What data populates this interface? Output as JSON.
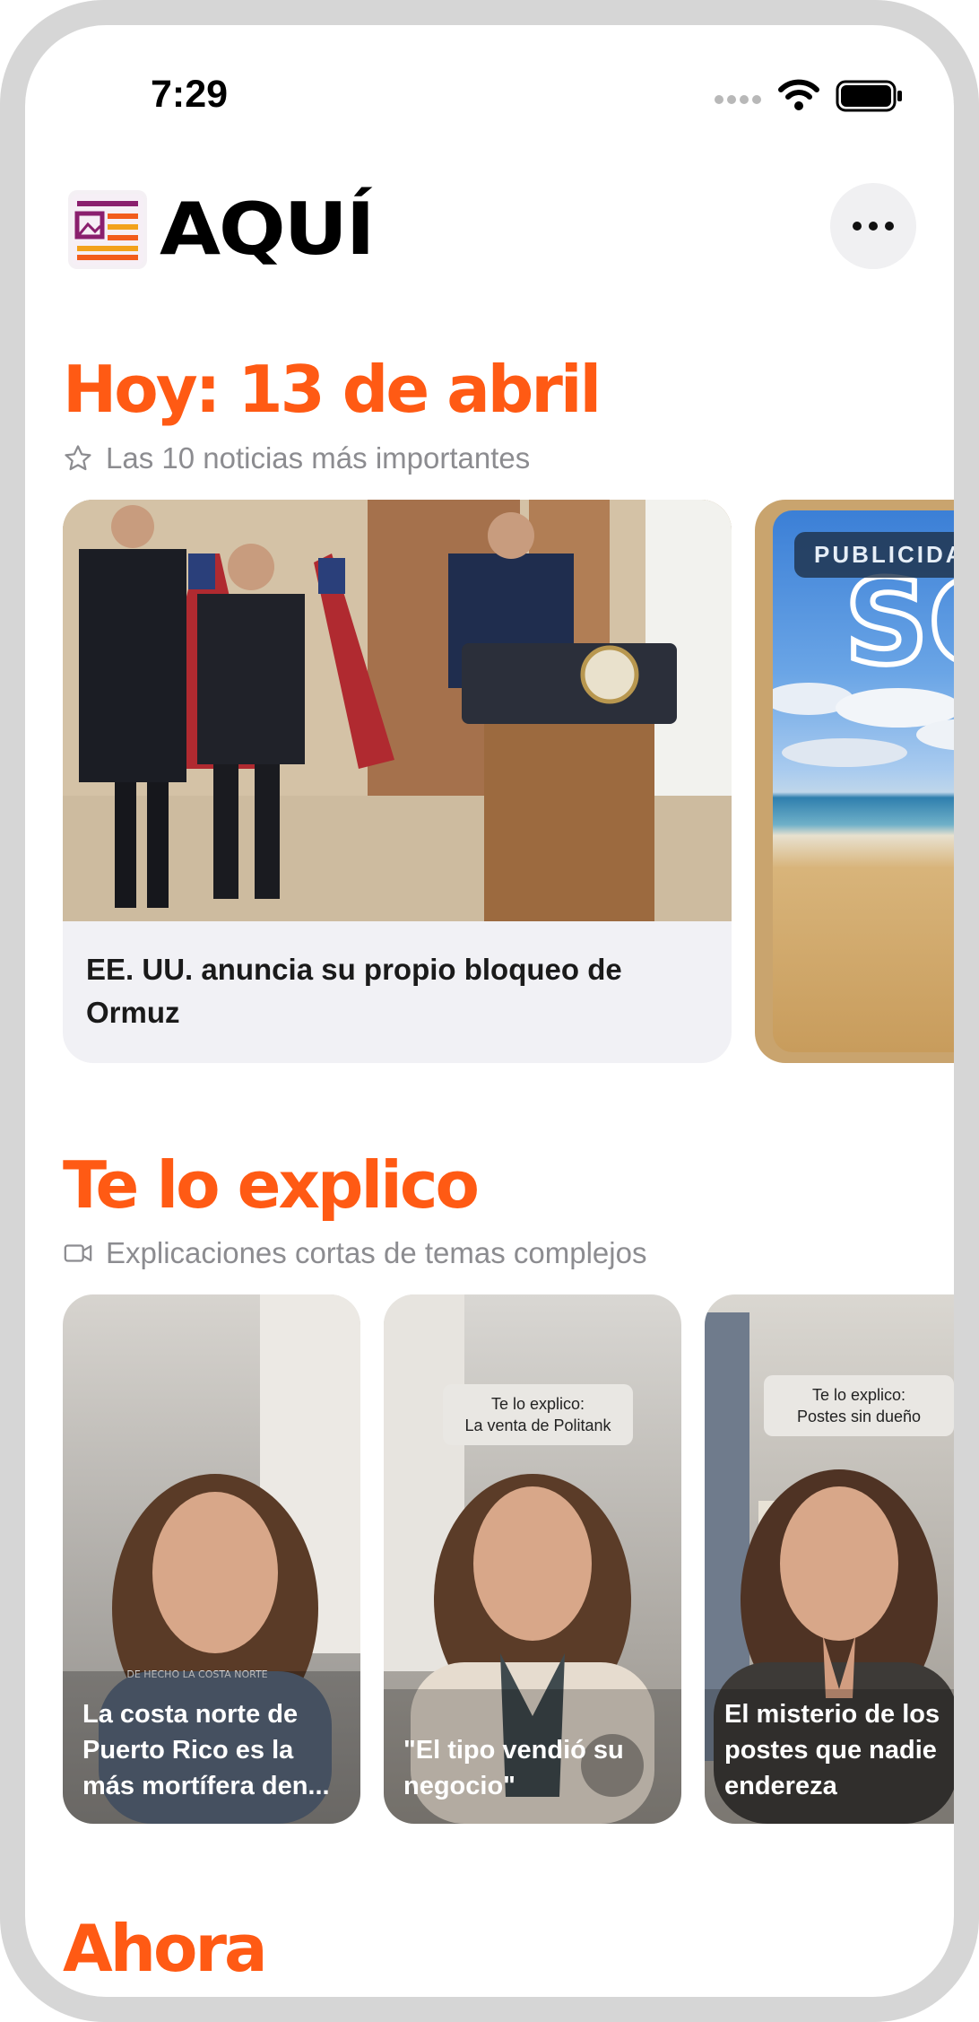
{
  "status_bar": {
    "time": "7:29"
  },
  "header": {
    "app_name": "AQUÍ",
    "more_icon": "ellipsis-icon"
  },
  "today": {
    "title": "Hoy: 13 de abril",
    "subtitle": "Las 10 noticias más importantes",
    "icon": "star-icon",
    "news": [
      {
        "headline": "EE. UU. anuncia su propio bloqueo de Ormuz"
      }
    ],
    "ad_badge": "PUBLICIDAD"
  },
  "explainer": {
    "title": "Te lo explico",
    "subtitle": "Explicaciones cortas de temas complejos",
    "icon": "video-icon",
    "videos": [
      {
        "title": "La costa norte de Puerto Rico es la más mortífera den...",
        "tag": "",
        "caption": "DE HECHO LA COSTA NORTE"
      },
      {
        "title": "\"El tipo vendió su negocio\"",
        "tag": "Te lo explico:\nLa venta de Politank",
        "caption": ""
      },
      {
        "title": "El misterio de los postes que nadie endereza",
        "tag": "Te lo explico:\nPostes sin dueño",
        "caption": ""
      }
    ]
  },
  "now": {
    "title": "Ahora"
  },
  "colors": {
    "accent": "#ff5a14",
    "subtle_text": "#8c8c90",
    "card_bg": "#f1f1f5"
  }
}
